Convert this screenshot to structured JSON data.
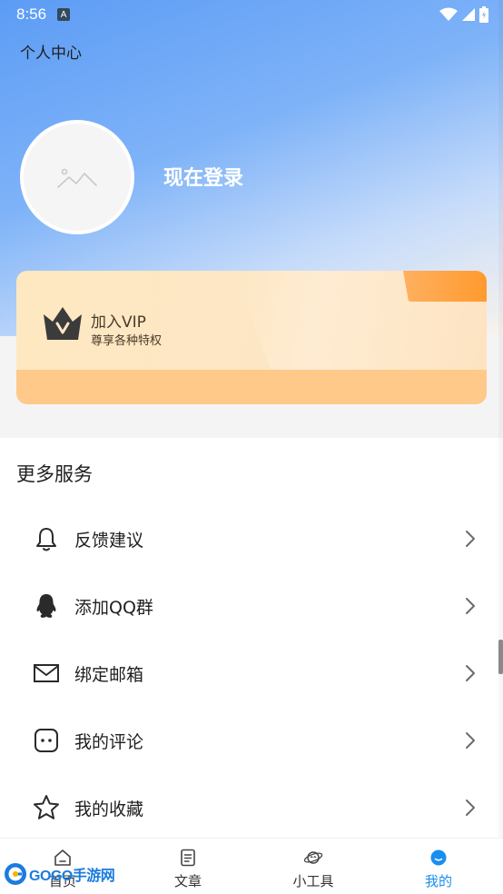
{
  "status_bar": {
    "time": "8:56",
    "notification_letter": "A"
  },
  "header": {
    "title": "个人中心"
  },
  "profile": {
    "login_label": "现在登录"
  },
  "vip": {
    "title": "加入VIP",
    "subtitle": "尊享各种特权"
  },
  "services": {
    "title": "更多服务",
    "items": [
      {
        "label": "反馈建议",
        "icon": "bell-icon"
      },
      {
        "label": "添加QQ群",
        "icon": "qq-penguin-icon"
      },
      {
        "label": "绑定邮箱",
        "icon": "mail-icon"
      },
      {
        "label": "我的评论",
        "icon": "comment-icon"
      },
      {
        "label": "我的收藏",
        "icon": "star-icon"
      }
    ]
  },
  "bottom_nav": {
    "items": [
      {
        "label": "首页",
        "icon": "home-icon"
      },
      {
        "label": "文章",
        "icon": "article-icon"
      },
      {
        "label": "小工具",
        "icon": "planet-icon"
      },
      {
        "label": "我的",
        "icon": "user-icon",
        "active": true
      }
    ]
  },
  "watermark": {
    "text": "GOGO手游网"
  },
  "colors": {
    "accent": "#1a8ef0",
    "vip_orange": "#ffc98a",
    "hero_blue": "#5c9cf5"
  }
}
